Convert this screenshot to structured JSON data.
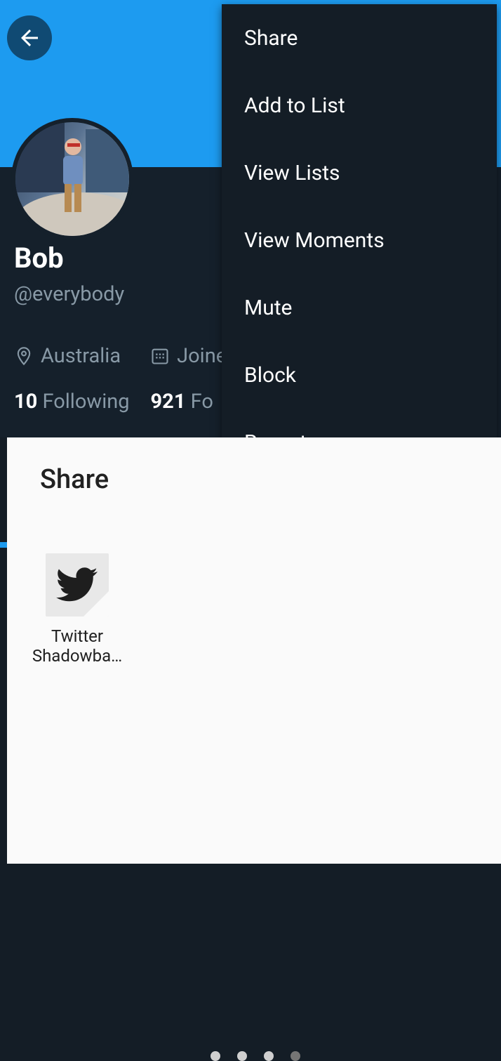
{
  "profile": {
    "name": "Bob",
    "handle": "@everybody",
    "location": "Australia",
    "joined": "Joined",
    "following_count": "10",
    "following_label": "Following",
    "followers_count": "921",
    "followers_label": "Fo"
  },
  "overflow_menu": {
    "items": [
      {
        "label": "Share"
      },
      {
        "label": "Add to List"
      },
      {
        "label": "View Lists"
      },
      {
        "label": "View Moments"
      },
      {
        "label": "Mute"
      },
      {
        "label": "Block"
      },
      {
        "label": "Report"
      }
    ]
  },
  "share_sheet": {
    "title": "Share",
    "apps": [
      {
        "line1": "Twitter",
        "line2": "Shadowba…",
        "icon": "twitter-bird-icon"
      }
    ],
    "page_count": 4,
    "active_page": 4
  },
  "colors": {
    "banner": "#1d9bf0",
    "background": "#15202b",
    "menu": "#141d26",
    "sheet": "#fafafa"
  }
}
